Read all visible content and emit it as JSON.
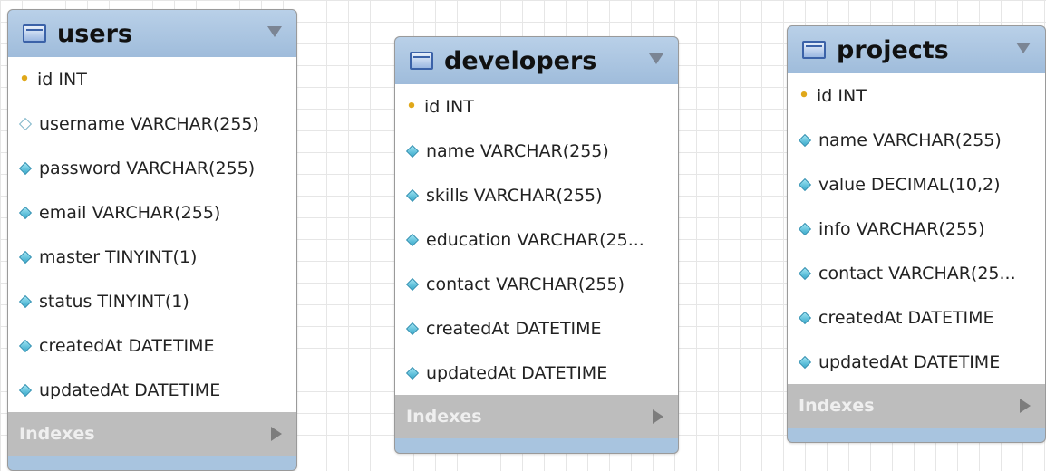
{
  "tables": [
    {
      "name": "users",
      "columns": [
        {
          "kind": "key",
          "text": "id INT"
        },
        {
          "kind": "hollow",
          "text": "username VARCHAR(255)"
        },
        {
          "kind": "filled",
          "text": "password VARCHAR(255)"
        },
        {
          "kind": "filled",
          "text": "email VARCHAR(255)"
        },
        {
          "kind": "filled",
          "text": "master TINYINT(1)"
        },
        {
          "kind": "filled",
          "text": "status TINYINT(1)"
        },
        {
          "kind": "filled",
          "text": "createdAt DATETIME"
        },
        {
          "kind": "filled",
          "text": "updatedAt DATETIME"
        }
      ],
      "indexes_label": "Indexes"
    },
    {
      "name": "developers",
      "columns": [
        {
          "kind": "key",
          "text": "id INT"
        },
        {
          "kind": "filled",
          "text": "name VARCHAR(255)"
        },
        {
          "kind": "filled",
          "text": "skills VARCHAR(255)"
        },
        {
          "kind": "filled",
          "text": "education VARCHAR(25..."
        },
        {
          "kind": "filled",
          "text": "contact VARCHAR(255)"
        },
        {
          "kind": "filled",
          "text": "createdAt DATETIME"
        },
        {
          "kind": "filled",
          "text": "updatedAt DATETIME"
        }
      ],
      "indexes_label": "Indexes"
    },
    {
      "name": "projects",
      "columns": [
        {
          "kind": "key",
          "text": "id INT"
        },
        {
          "kind": "filled",
          "text": "name VARCHAR(255)"
        },
        {
          "kind": "filled",
          "text": "value DECIMAL(10,2)"
        },
        {
          "kind": "filled",
          "text": "info VARCHAR(255)"
        },
        {
          "kind": "filled",
          "text": "contact VARCHAR(25..."
        },
        {
          "kind": "filled",
          "text": "createdAt DATETIME"
        },
        {
          "kind": "filled",
          "text": "updatedAt DATETIME"
        }
      ],
      "indexes_label": "Indexes"
    }
  ]
}
